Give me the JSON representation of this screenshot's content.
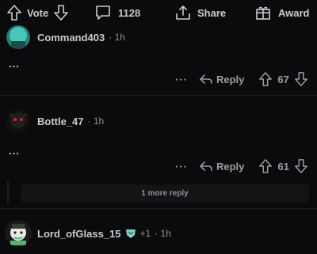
{
  "post_actions": {
    "vote_label": "Vote",
    "comment_count": "1128",
    "share_label": "Share",
    "award_label": "Award"
  },
  "comments": [
    {
      "username": "Command403",
      "time": "· 1h",
      "body": "...",
      "more": "···",
      "reply_label": "Reply",
      "score": "67"
    },
    {
      "username": "Bottle_47",
      "time": "· 1h",
      "body": "...",
      "more": "···",
      "reply_label": "Reply",
      "score": "61",
      "more_replies": "1 more reply"
    },
    {
      "username": "Lord_ofGlass_15",
      "flair_count": "+1",
      "time": "· 1h"
    }
  ],
  "colors": {
    "background": "#0b0b0d",
    "text": "#c8cbcd",
    "muted": "#8f9295",
    "avatar1": "#48c8b8",
    "avatar2_eyes": "#e0201c"
  },
  "icons": {
    "upvote": "arrow-up-icon",
    "downvote": "arrow-down-icon",
    "comment": "speech-bubble-icon",
    "share": "share-icon",
    "award": "gift-icon",
    "reply": "reply-arrow-icon"
  }
}
